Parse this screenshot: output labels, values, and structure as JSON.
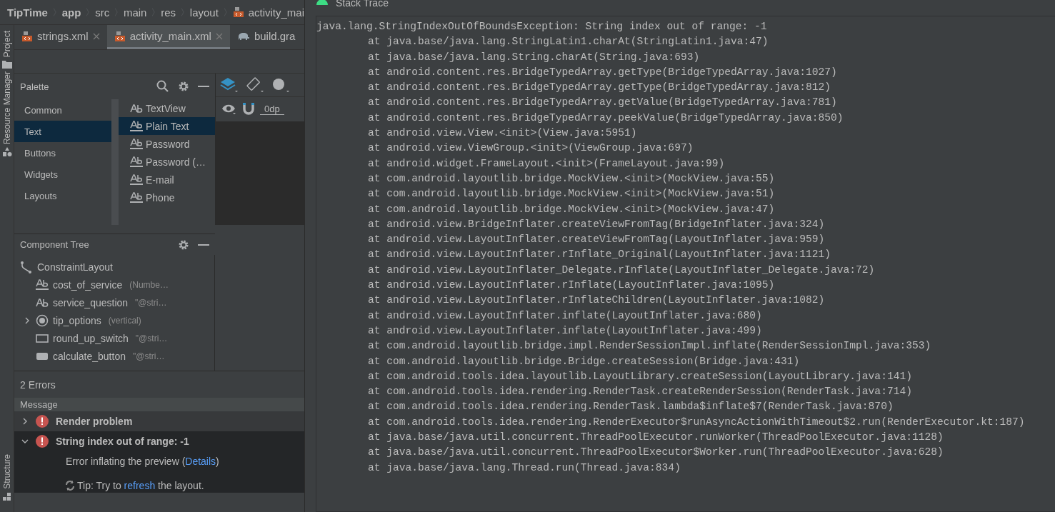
{
  "breadcrumbs": [
    {
      "label": "TipTime",
      "bold": true,
      "kind": "plain"
    },
    {
      "label": "app",
      "bold": true,
      "kind": "plain"
    },
    {
      "label": "src",
      "bold": false,
      "kind": "plain"
    },
    {
      "label": "main",
      "bold": false,
      "kind": "plain"
    },
    {
      "label": "res",
      "bold": false,
      "kind": "plain"
    },
    {
      "label": "layout",
      "bold": false,
      "kind": "plain"
    },
    {
      "label": "activity_mai",
      "bold": false,
      "kind": "xml"
    }
  ],
  "side_tools": [
    {
      "label": "Project",
      "kind": "folder"
    },
    {
      "label": "Resource Manager",
      "kind": "shapes"
    },
    {
      "label": "Structure",
      "kind": "blocks"
    }
  ],
  "tabs": [
    {
      "label": "strings.xml",
      "kind": "xml",
      "selected": false,
      "closable": true
    },
    {
      "label": "activity_main.xml",
      "kind": "xml",
      "selected": true,
      "closable": true
    },
    {
      "label": "build.gra",
      "kind": "gradle",
      "selected": false,
      "closable": false
    }
  ],
  "palette": {
    "title": "Palette",
    "categories": [
      {
        "label": "Common",
        "selected": false
      },
      {
        "label": "Text",
        "selected": true
      },
      {
        "label": "Buttons",
        "selected": false
      },
      {
        "label": "Widgets",
        "selected": false
      },
      {
        "label": "Layouts",
        "selected": false
      }
    ],
    "items": [
      {
        "label": "TextView",
        "kind": "textview",
        "selected": false
      },
      {
        "label": "Plain Text",
        "kind": "edittext",
        "selected": true
      },
      {
        "label": "Password",
        "kind": "edittext",
        "selected": false
      },
      {
        "label": "Password (…",
        "kind": "edittext",
        "selected": false
      },
      {
        "label": "E-mail",
        "kind": "edittext",
        "selected": false
      },
      {
        "label": "Phone",
        "kind": "edittext",
        "selected": false
      }
    ]
  },
  "design_toolbar": {
    "margin": "0dp"
  },
  "component_tree": {
    "title": "Component Tree",
    "items": [
      {
        "name": "ConstraintLayout",
        "kind": "constraint"
      },
      {
        "name": "cost_of_service",
        "kind": "edittext",
        "detail": "(Numbe…"
      },
      {
        "name": "service_question",
        "kind": "textview",
        "detail": "\"@stri…"
      },
      {
        "name": "tip_options",
        "kind": "radiogroup",
        "detail": "(vertical)",
        "expanded": false
      },
      {
        "name": "round_up_switch",
        "kind": "switch",
        "detail": "\"@stri…"
      },
      {
        "name": "calculate_button",
        "kind": "button",
        "detail": "\"@stri…"
      }
    ]
  },
  "problems": {
    "title": "2 Errors",
    "column": "Message",
    "items": [
      {
        "title": "Render problem",
        "expanded": false,
        "selected": false
      },
      {
        "title": "String index out of range: -1",
        "expanded": true,
        "selected": true,
        "description": {
          "before": "Error inflating the preview (",
          "link": "Details",
          "after": ")"
        },
        "tip": {
          "before": "Tip: Try to ",
          "link": "refresh",
          "after": " the layout."
        }
      }
    ]
  },
  "stack_trace": {
    "title": "Stack Trace",
    "lines": [
      {
        "kind": "exception",
        "text": "java.lang.StringIndexOutOfBoundsException: String index out of range: -1"
      },
      {
        "kind": "frame",
        "text": "at java.base/java.lang.StringLatin1.charAt(StringLatin1.java:47)"
      },
      {
        "kind": "frame",
        "text": "at java.base/java.lang.String.charAt(String.java:693)"
      },
      {
        "kind": "frame",
        "text": "at android.content.res.BridgeTypedArray.getType(BridgeTypedArray.java:1027)"
      },
      {
        "kind": "frame",
        "text": "at android.content.res.BridgeTypedArray.getType(BridgeTypedArray.java:812)"
      },
      {
        "kind": "frame",
        "text": "at android.content.res.BridgeTypedArray.getValue(BridgeTypedArray.java:781)"
      },
      {
        "kind": "frame",
        "text": "at android.content.res.BridgeTypedArray.peekValue(BridgeTypedArray.java:850)"
      },
      {
        "kind": "frame",
        "text": "at android.view.View.<init>(View.java:5951)"
      },
      {
        "kind": "frame",
        "text": "at android.view.ViewGroup.<init>(ViewGroup.java:697)"
      },
      {
        "kind": "frame",
        "text": "at android.widget.FrameLayout.<init>(FrameLayout.java:99)"
      },
      {
        "kind": "frame",
        "text": "at com.android.layoutlib.bridge.MockView.<init>(MockView.java:55)"
      },
      {
        "kind": "frame",
        "text": "at com.android.layoutlib.bridge.MockView.<init>(MockView.java:51)"
      },
      {
        "kind": "frame",
        "text": "at com.android.layoutlib.bridge.MockView.<init>(MockView.java:47)"
      },
      {
        "kind": "frame",
        "text": "at android.view.BridgeInflater.createViewFromTag(BridgeInflater.java:324)"
      },
      {
        "kind": "frame",
        "text": "at android.view.LayoutInflater.createViewFromTag(LayoutInflater.java:959)"
      },
      {
        "kind": "frame",
        "text": "at android.view.LayoutInflater.rInflate_Original(LayoutInflater.java:1121)"
      },
      {
        "kind": "frame",
        "text": "at android.view.LayoutInflater_Delegate.rInflate(LayoutInflater_Delegate.java:72)"
      },
      {
        "kind": "frame",
        "text": "at android.view.LayoutInflater.rInflate(LayoutInflater.java:1095)"
      },
      {
        "kind": "frame",
        "text": "at android.view.LayoutInflater.rInflateChildren(LayoutInflater.java:1082)"
      },
      {
        "kind": "frame",
        "text": "at android.view.LayoutInflater.inflate(LayoutInflater.java:680)"
      },
      {
        "kind": "frame",
        "text": "at android.view.LayoutInflater.inflate(LayoutInflater.java:499)"
      },
      {
        "kind": "frame",
        "text": "at com.android.layoutlib.bridge.impl.RenderSessionImpl.inflate(RenderSessionImpl.java:353)"
      },
      {
        "kind": "frame",
        "text": "at com.android.layoutlib.bridge.Bridge.createSession(Bridge.java:431)"
      },
      {
        "kind": "frame",
        "text": "at com.android.tools.idea.layoutlib.LayoutLibrary.createSession(LayoutLibrary.java:141)"
      },
      {
        "kind": "frame",
        "text": "at com.android.tools.idea.rendering.RenderTask.createRenderSession(RenderTask.java:714)"
      },
      {
        "kind": "frame",
        "text": "at com.android.tools.idea.rendering.RenderTask.lambda$inflate$7(RenderTask.java:870)"
      },
      {
        "kind": "frame",
        "text": "at com.android.tools.idea.rendering.RenderExecutor$runAsyncActionWithTimeout$2.run(RenderExecutor.kt:187)"
      },
      {
        "kind": "frame",
        "text": "at java.base/java.util.concurrent.ThreadPoolExecutor.runWorker(ThreadPoolExecutor.java:1128)"
      },
      {
        "kind": "frame",
        "text": "at java.base/java.util.concurrent.ThreadPoolExecutor$Worker.run(ThreadPoolExecutor.java:628)"
      },
      {
        "kind": "frame",
        "text": "at java.base/java.lang.Thread.run(Thread.java:834)"
      }
    ]
  }
}
